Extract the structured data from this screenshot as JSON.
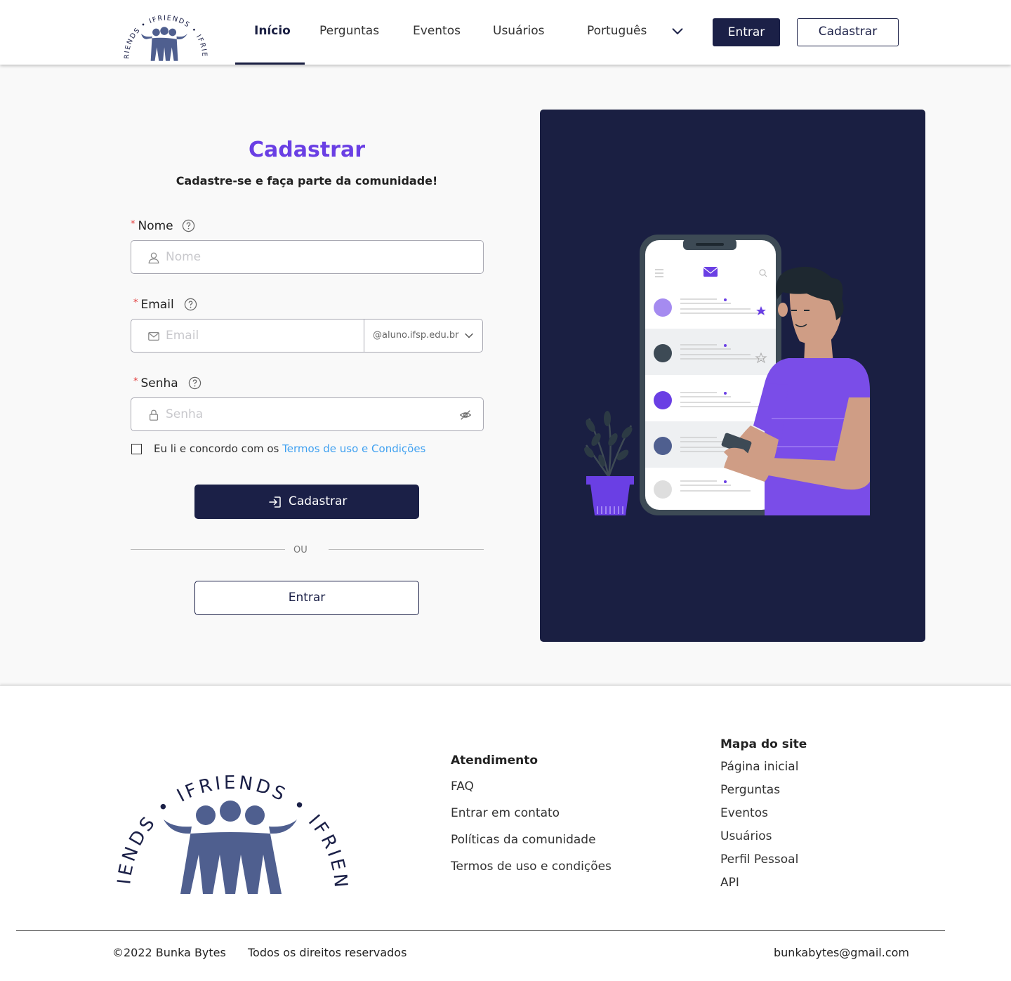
{
  "brand": {
    "logo_text": "IFRIENDS",
    "logo_color": "#4f5f8f"
  },
  "nav": {
    "items": [
      {
        "label": "Início",
        "active": true
      },
      {
        "label": "Perguntas"
      },
      {
        "label": "Eventos"
      },
      {
        "label": "Usuários"
      }
    ],
    "language": "Português",
    "login_label": "Entrar",
    "signup_label": "Cadastrar"
  },
  "form": {
    "title": "Cadastrar",
    "subtitle": "Cadastre-se e faça parte da comunidade!",
    "name": {
      "label": "Nome",
      "placeholder": "Nome",
      "value": ""
    },
    "email": {
      "label": "Email",
      "placeholder": "Email",
      "value": "",
      "domain": "@aluno.ifsp.edu.br"
    },
    "password": {
      "label": "Senha",
      "placeholder": "Senha",
      "value": ""
    },
    "terms_prefix": "Eu li e concordo com os",
    "terms_link": "Termos de uso e Condições",
    "terms_checked": false,
    "submit_label": "Cadastrar",
    "divider_text": "OU",
    "login_label": "Entrar"
  },
  "colors": {
    "primary": "#1b2047",
    "accent": "#6a3fe4",
    "link": "#3fa0f0",
    "required": "#e23b3b"
  },
  "footer": {
    "support": {
      "heading": "Atendimento",
      "links": [
        "FAQ",
        "Entrar em contato",
        "Políticas da comunidade",
        "Termos de uso e condições"
      ]
    },
    "sitemap": {
      "heading": "Mapa do site",
      "links": [
        "Página inicial",
        "Perguntas",
        "Eventos",
        "Usuários",
        "Perfil Pessoal",
        "API"
      ]
    },
    "copyright": "©2022 Bunka Bytes",
    "rights": "Todos os direitos reservados",
    "email": "bunkabytes@gmail.com"
  }
}
